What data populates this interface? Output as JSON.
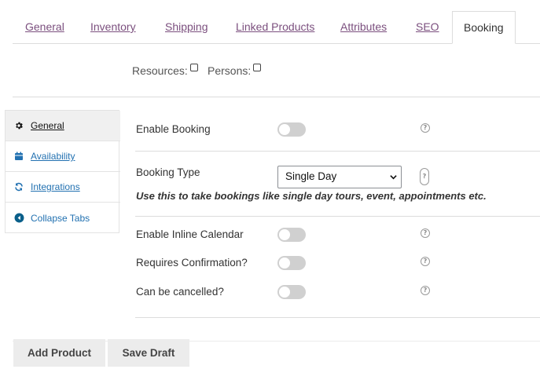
{
  "tabs": [
    {
      "label": "General"
    },
    {
      "label": "Inventory"
    },
    {
      "label": "Shipping"
    },
    {
      "label": "Linked Products"
    },
    {
      "label": "Attributes"
    },
    {
      "label": "SEO"
    },
    {
      "label": "Booking",
      "active": true
    }
  ],
  "options": {
    "resources_label": "Resources:",
    "resources_checked": false,
    "persons_label": "Persons:",
    "persons_checked": false
  },
  "sidebar": {
    "items": [
      {
        "label": "General",
        "icon": "gear-icon",
        "active": true
      },
      {
        "label": "Availability",
        "icon": "calendar-icon"
      },
      {
        "label": "Integrations",
        "icon": "sync-icon"
      },
      {
        "label": "Collapse Tabs",
        "icon": "collapse-arrow-icon"
      }
    ]
  },
  "form": {
    "enable_booking": {
      "label": "Enable Booking",
      "enabled": false
    },
    "booking_type": {
      "label": "Booking Type",
      "selected": "Single Day",
      "description": "Use this to take bookings like single day tours, event, appointments etc."
    },
    "inline_calendar": {
      "label": "Enable Inline Calendar",
      "enabled": false
    },
    "requires_confirmation": {
      "label": "Requires Confirmation?",
      "enabled": false
    },
    "can_be_cancelled": {
      "label": "Can be cancelled?",
      "enabled": false
    },
    "help_glyph": "?"
  },
  "actions": {
    "add_product": "Add Product",
    "save_draft": "Save Draft"
  },
  "colors": {
    "tab_link": "#7b4f7e",
    "sidebar_link": "#2271b1",
    "toggle_off": "#d0d0d0",
    "button_bg": "#ececec"
  }
}
